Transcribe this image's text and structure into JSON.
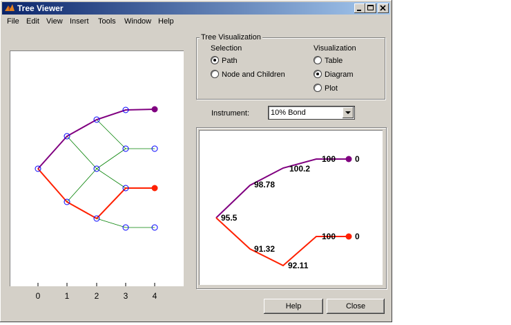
{
  "window": {
    "title": "Tree Viewer"
  },
  "menu": [
    "File",
    "Edit",
    "View",
    "Insert",
    "Tools",
    "Window",
    "Help"
  ],
  "tree_visualization": {
    "legend": "Tree Visualization",
    "selection_label": "Selection",
    "selection_options": [
      "Path",
      "Node and Children"
    ],
    "selection_selected": "Path",
    "visualization_label": "Visualization",
    "visualization_options": [
      "Table",
      "Diagram",
      "Plot"
    ],
    "visualization_selected": "Diagram"
  },
  "instrument": {
    "label": "Instrument:",
    "value": "10% Bond"
  },
  "tree_plot": {
    "x_ticks": [
      "0",
      "1",
      "2",
      "3",
      "4"
    ],
    "colors": {
      "path_up": "#800080",
      "path_down": "#ff2000",
      "edges": "#008000",
      "nodes": "#0000ff"
    }
  },
  "diagram": {
    "values": [
      "95.5",
      "98.78",
      "100.2",
      "100",
      "0",
      "91.32",
      "92.11",
      "100",
      "0"
    ]
  },
  "buttons": {
    "help": "Help",
    "close": "Close"
  }
}
